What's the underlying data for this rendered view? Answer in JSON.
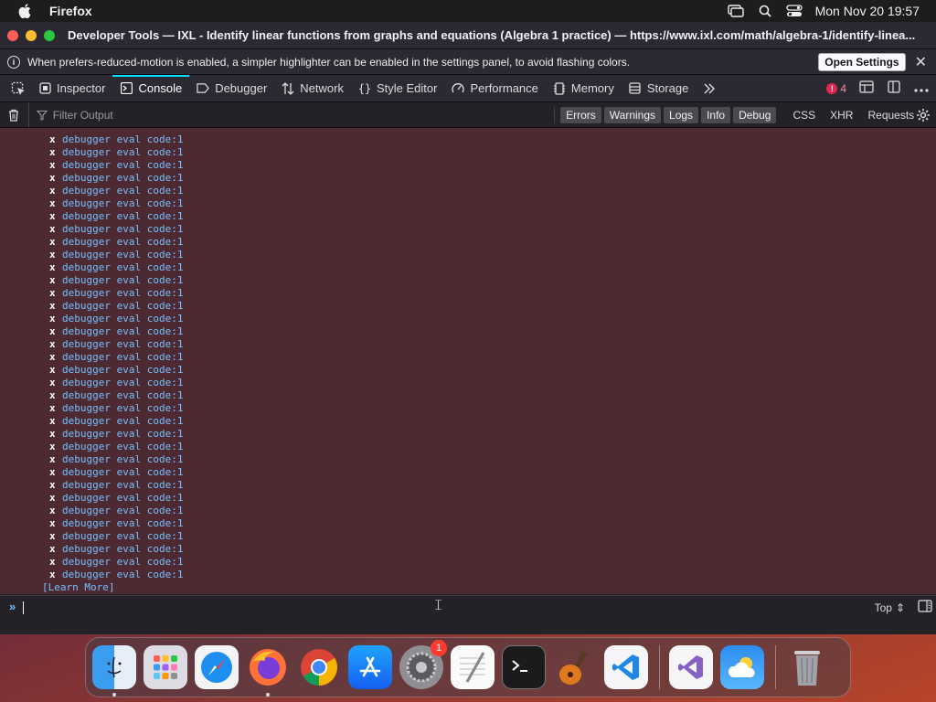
{
  "menubar": {
    "app_name": "Firefox",
    "clock": "Mon Nov 20  19:57"
  },
  "window": {
    "title": "Developer Tools — IXL - Identify linear functions from graphs and equations (Algebra 1 practice) — https://www.ixl.com/math/algebra-1/identify-linea..."
  },
  "notice": {
    "text": "When prefers-reduced-motion is enabled, a simpler highlighter can be enabled in the settings panel, to avoid flashing colors.",
    "button": "Open Settings"
  },
  "toolbar": {
    "tabs": [
      {
        "label": "Inspector",
        "icon": "inspector-icon"
      },
      {
        "label": "Console",
        "icon": "console-icon",
        "active": true
      },
      {
        "label": "Debugger",
        "icon": "debugger-icon"
      },
      {
        "label": "Network",
        "icon": "network-icon"
      },
      {
        "label": "Style Editor",
        "icon": "style-editor-icon"
      },
      {
        "label": "Performance",
        "icon": "performance-icon"
      },
      {
        "label": "Memory",
        "icon": "memory-icon"
      },
      {
        "label": "Storage",
        "icon": "storage-icon"
      }
    ],
    "error_count": "4",
    "accent": "#00ddff"
  },
  "filter": {
    "placeholder": "Filter Output",
    "levels": [
      "Errors",
      "Warnings",
      "Logs",
      "Info",
      "Debug"
    ],
    "types": [
      "CSS",
      "XHR",
      "Requests"
    ]
  },
  "console": {
    "entry_marker": "x",
    "entry_link": "debugger eval code:1",
    "entry_count": 35,
    "learn_more": "[Learn More]",
    "background": "#4d2a32"
  },
  "input": {
    "context": "Top"
  },
  "dock": {
    "apps": [
      {
        "name": "Finder",
        "icon": "finder-icon",
        "running": true
      },
      {
        "name": "Launchpad",
        "icon": "launchpad-icon"
      },
      {
        "name": "Safari",
        "icon": "safari-icon"
      },
      {
        "name": "Firefox",
        "icon": "firefox-icon",
        "running": true
      },
      {
        "name": "Chrome",
        "icon": "chrome-icon"
      },
      {
        "name": "App Store",
        "icon": "app-store-icon"
      },
      {
        "name": "System Settings",
        "icon": "settings-icon",
        "badge": "1"
      },
      {
        "name": "TextEdit",
        "icon": "textedit-icon"
      },
      {
        "name": "Terminal",
        "icon": "terminal-icon"
      },
      {
        "name": "GarageBand",
        "icon": "garageband-icon"
      },
      {
        "name": "VS Code",
        "icon": "vscode-icon"
      },
      {
        "name": "Visual Studio",
        "icon": "visual-studio-icon"
      },
      {
        "name": "Weather",
        "icon": "weather-icon"
      },
      {
        "name": "Trash",
        "icon": "trash-icon"
      }
    ]
  }
}
